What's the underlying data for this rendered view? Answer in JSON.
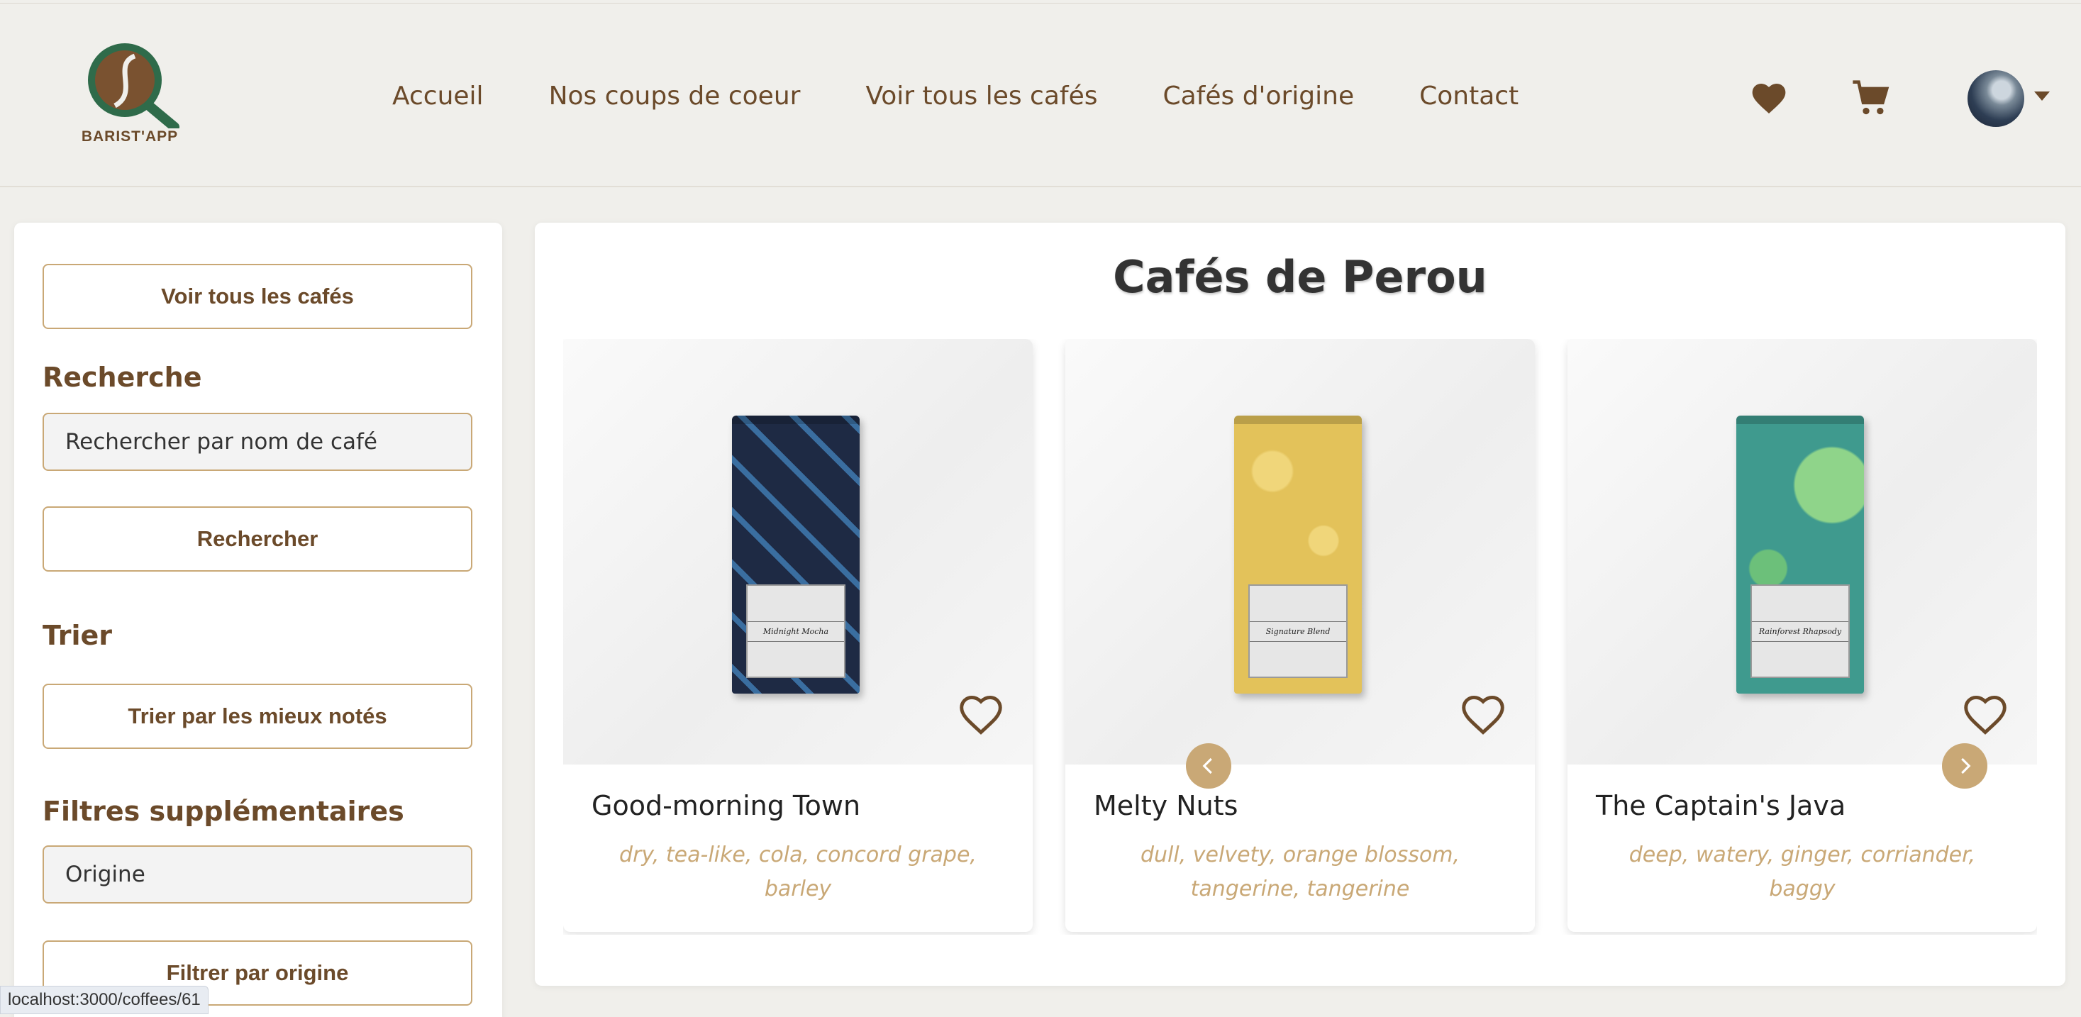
{
  "header": {
    "logo_text": "BARIST'APP",
    "nav": [
      "Accueil",
      "Nos coups de coeur",
      "Voir tous les cafés",
      "Cafés d'origine",
      "Contact"
    ],
    "icons": [
      "heart-icon",
      "cart-icon",
      "avatar",
      "caret-down-icon"
    ]
  },
  "sidebar": {
    "all_coffees_button": "Voir tous les cafés",
    "search_heading": "Recherche",
    "search_placeholder": "Rechercher par nom de café",
    "search_button": "Rechercher",
    "sort_heading": "Trier",
    "sort_button": "Trier par les mieux notés",
    "filters_heading": "Filtres supplémentaires",
    "origin_select": "Origine",
    "filter_button": "Filtrer par origine"
  },
  "main": {
    "title": "Cafés de Perou",
    "cards": [
      {
        "name": "Good-morning Town",
        "notes": "dry, tea-like, cola, concord grape, barley",
        "bag_label": "Midnight Mocha",
        "bag_color": "#1e2a44"
      },
      {
        "name": "Melty Nuts",
        "notes": "dull, velvety, orange blossom, tangerine, tangerine",
        "bag_label": "Signature Blend",
        "bag_color": "#e3c25a"
      },
      {
        "name": "The Captain's Java",
        "notes": "deep, watery, ginger, corriander, baggy",
        "bag_label": "Rainforest Rhapsody",
        "bag_color": "#3f9a8e"
      }
    ]
  },
  "colors": {
    "accent": "#c9a876",
    "brand_brown": "#6b4a2a",
    "background": "#f0efeb"
  },
  "status_bar": "localhost:3000/coffees/61"
}
